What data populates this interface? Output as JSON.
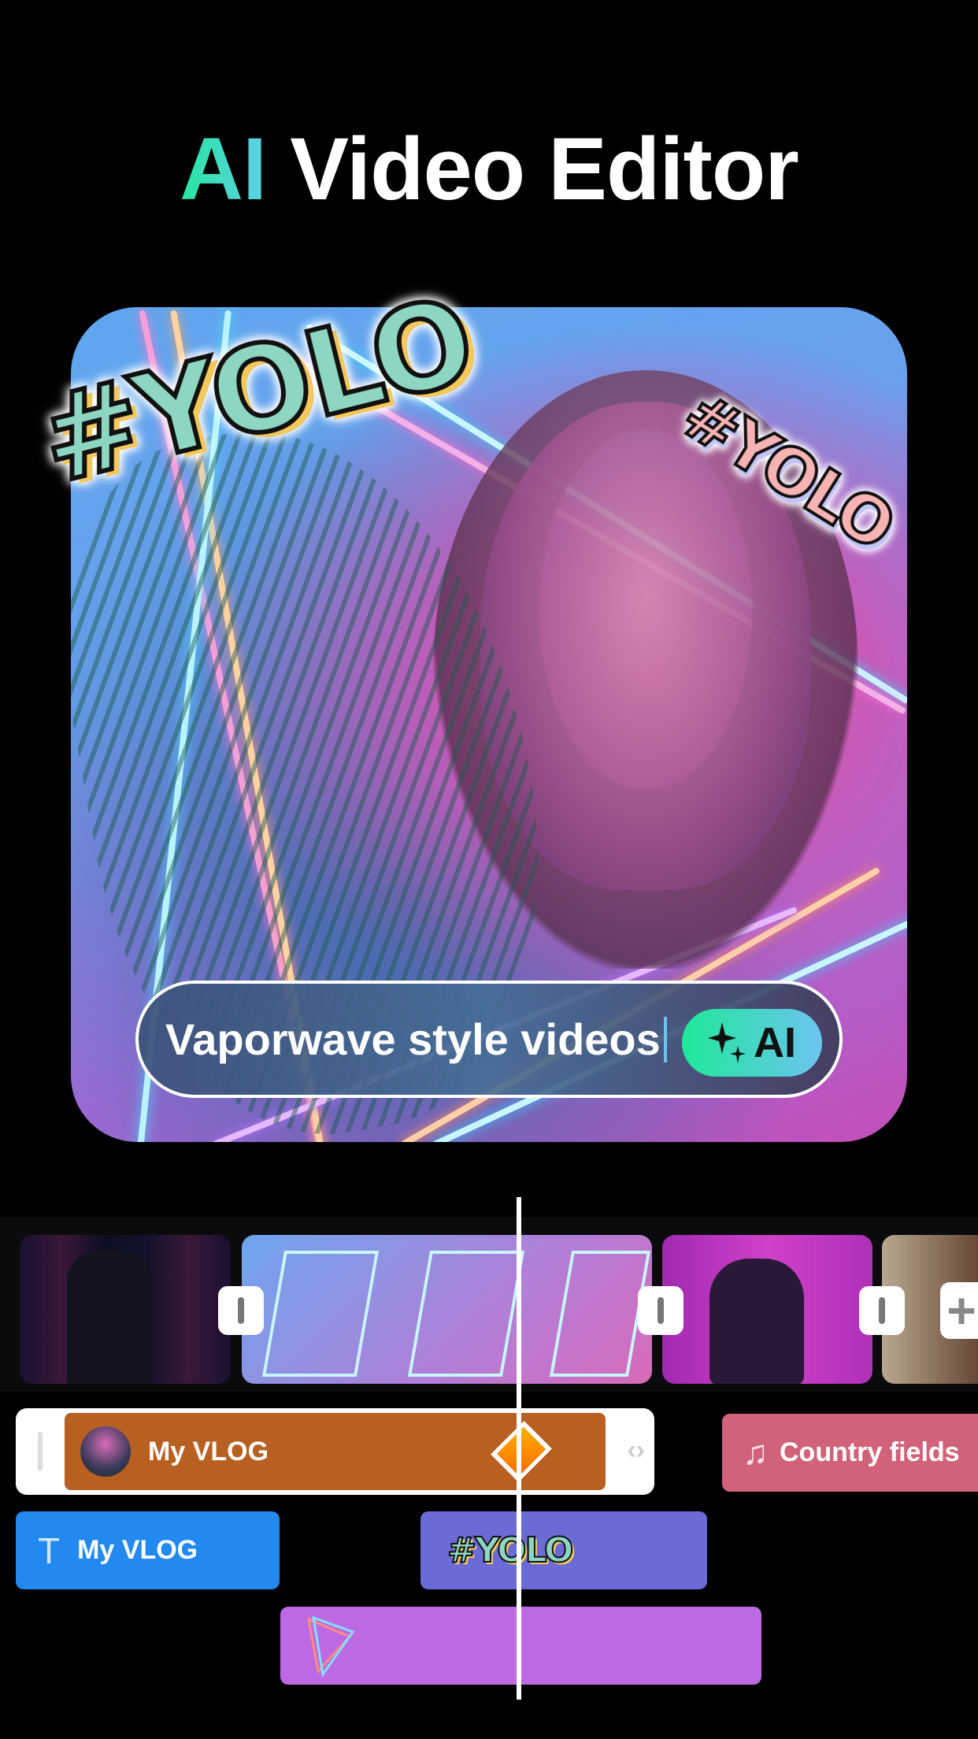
{
  "header": {
    "title_accent": "AI",
    "title_rest": " Video Editor"
  },
  "preview": {
    "stickers": [
      "#YOLO",
      "#YOLO"
    ],
    "prompt_input": {
      "value": "Vaporwave style videos",
      "ai_button": "AI",
      "ai_icon": "sparkles-icon"
    }
  },
  "timeline": {
    "video_clips": [
      "man-neon-clip",
      "vaporwave-clip",
      "woman-pink-clip",
      "woman-street-clip"
    ],
    "add_icon": "plus-icon",
    "tracks": {
      "vlog_clip": {
        "label": "My VLOG",
        "color": "#b85f22"
      },
      "music_clip": {
        "label": "Country fields",
        "icon": "music-note-icon",
        "color": "#d2627a"
      },
      "text_clip": {
        "label": "My VLOG",
        "icon": "text-icon",
        "color": "#2189ef"
      },
      "sticker_clip": {
        "label": "#YOLO",
        "color": "#6b6bd8"
      },
      "effect_clip": {
        "icon": "triangle-effect-icon",
        "color": "#bd6ae2"
      }
    }
  },
  "colors": {
    "accent": "#27e6a0",
    "background": "#000000"
  }
}
